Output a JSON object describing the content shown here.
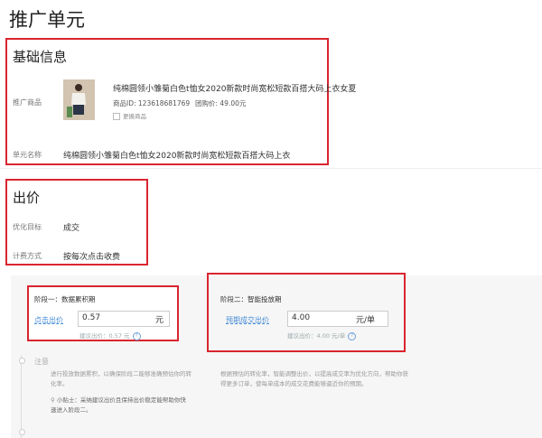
{
  "page": {
    "title": "推广单元"
  },
  "basic_info": {
    "title": "基础信息",
    "product_label": "推广商品",
    "product_name": "纯棉圆领小雏菊白色t恤女2020新款时尚宽松短款百搭大码上衣女夏",
    "product_id": "商品ID: 123618681769",
    "group_price": "团购价: 49.00元",
    "change_product": "更换商品",
    "unit_name_label": "单元名称",
    "unit_name_value": "纯棉圆领小雏菊白色t恤女2020新款时尚宽松短款百搭大码上衣"
  },
  "bid": {
    "title": "出价",
    "goal_label": "优化目标",
    "goal_value": "成交",
    "billing_label": "计费方式",
    "billing_value": "按每次点击收费"
  },
  "stage1": {
    "title": "阶段一：数据累积期",
    "field_label": "点击出价",
    "field_value": "0.57",
    "unit": "元",
    "suggest": "建议出价：0.57 元"
  },
  "stage2": {
    "title": "阶段二：智能投放期",
    "field_label": "预期成交出价",
    "field_value": "4.00",
    "unit": "元/单",
    "suggest": "建议出价：4.00 元/单"
  },
  "notes": {
    "heading": "注意",
    "stage1_desc": "进行投放数据累积，以确保阶段二能够准确预估你的转化率。",
    "tip": "小贴士：采纳建议出价且保持出价稳定能帮助你快速进入阶段二。",
    "stage2_desc": "根据预估的转化率，智能调整出价，以提高成交率为优化方向，帮助你获得更多订单，使每单成本的成交花费能够逼近你的预期。"
  },
  "colors": {
    "highlight": "#d9252f",
    "link": "#4a8fd8"
  }
}
